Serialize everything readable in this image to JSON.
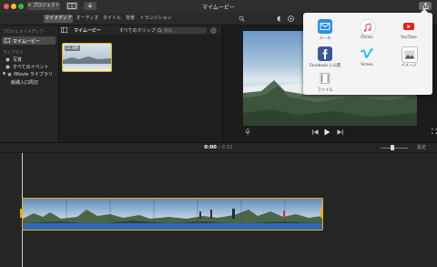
{
  "window": {
    "title": "マイムービー",
    "back_label": "< プロジェクト"
  },
  "tabs": [
    {
      "label": "マイメディア",
      "active": true
    },
    {
      "label": "オーディオ",
      "active": false
    },
    {
      "label": "タイトル",
      "active": false
    },
    {
      "label": "背景",
      "active": false
    },
    {
      "label": "トランジション",
      "active": false
    }
  ],
  "sidebar": {
    "project_media_header": "プロジェクトメディア",
    "project_item": "マイムービー",
    "libraries_header": "ライブラリ",
    "library_items": [
      "写真",
      "すべてのイベント"
    ],
    "imovie_library": "iMovie ライブラリ",
    "event_item": "飯縄入口周辺"
  },
  "browser": {
    "title": "マイムービー",
    "filter": "すべてのクリップ ◊",
    "search_placeholder": "検索",
    "clip_duration": "31.8秒"
  },
  "timeline": {
    "current_time": "0:00",
    "separator": "/",
    "total_time": "0:32",
    "settings_label": "設定"
  },
  "share_menu": {
    "items": [
      {
        "label": "メール",
        "icon": "mail-icon",
        "color": "#2b8ee8"
      },
      {
        "label": "iTunes",
        "icon": "itunes-icon",
        "color": "#f03d78"
      },
      {
        "label": "YouTube",
        "icon": "youtube-icon",
        "color": "#e62117"
      },
      {
        "label": "Facebook に公開",
        "icon": "facebook-icon",
        "color": "#3b5998"
      },
      {
        "label": "Vimeo",
        "icon": "vimeo-icon",
        "color": "#1ab7ea"
      },
      {
        "label": "イメージ",
        "icon": "image-icon",
        "color": "#666666"
      },
      {
        "label": "ファイル",
        "icon": "file-icon",
        "color": "#888888"
      }
    ]
  },
  "colors": {
    "accent": "#e8b400",
    "playhead": "#e8b400"
  }
}
